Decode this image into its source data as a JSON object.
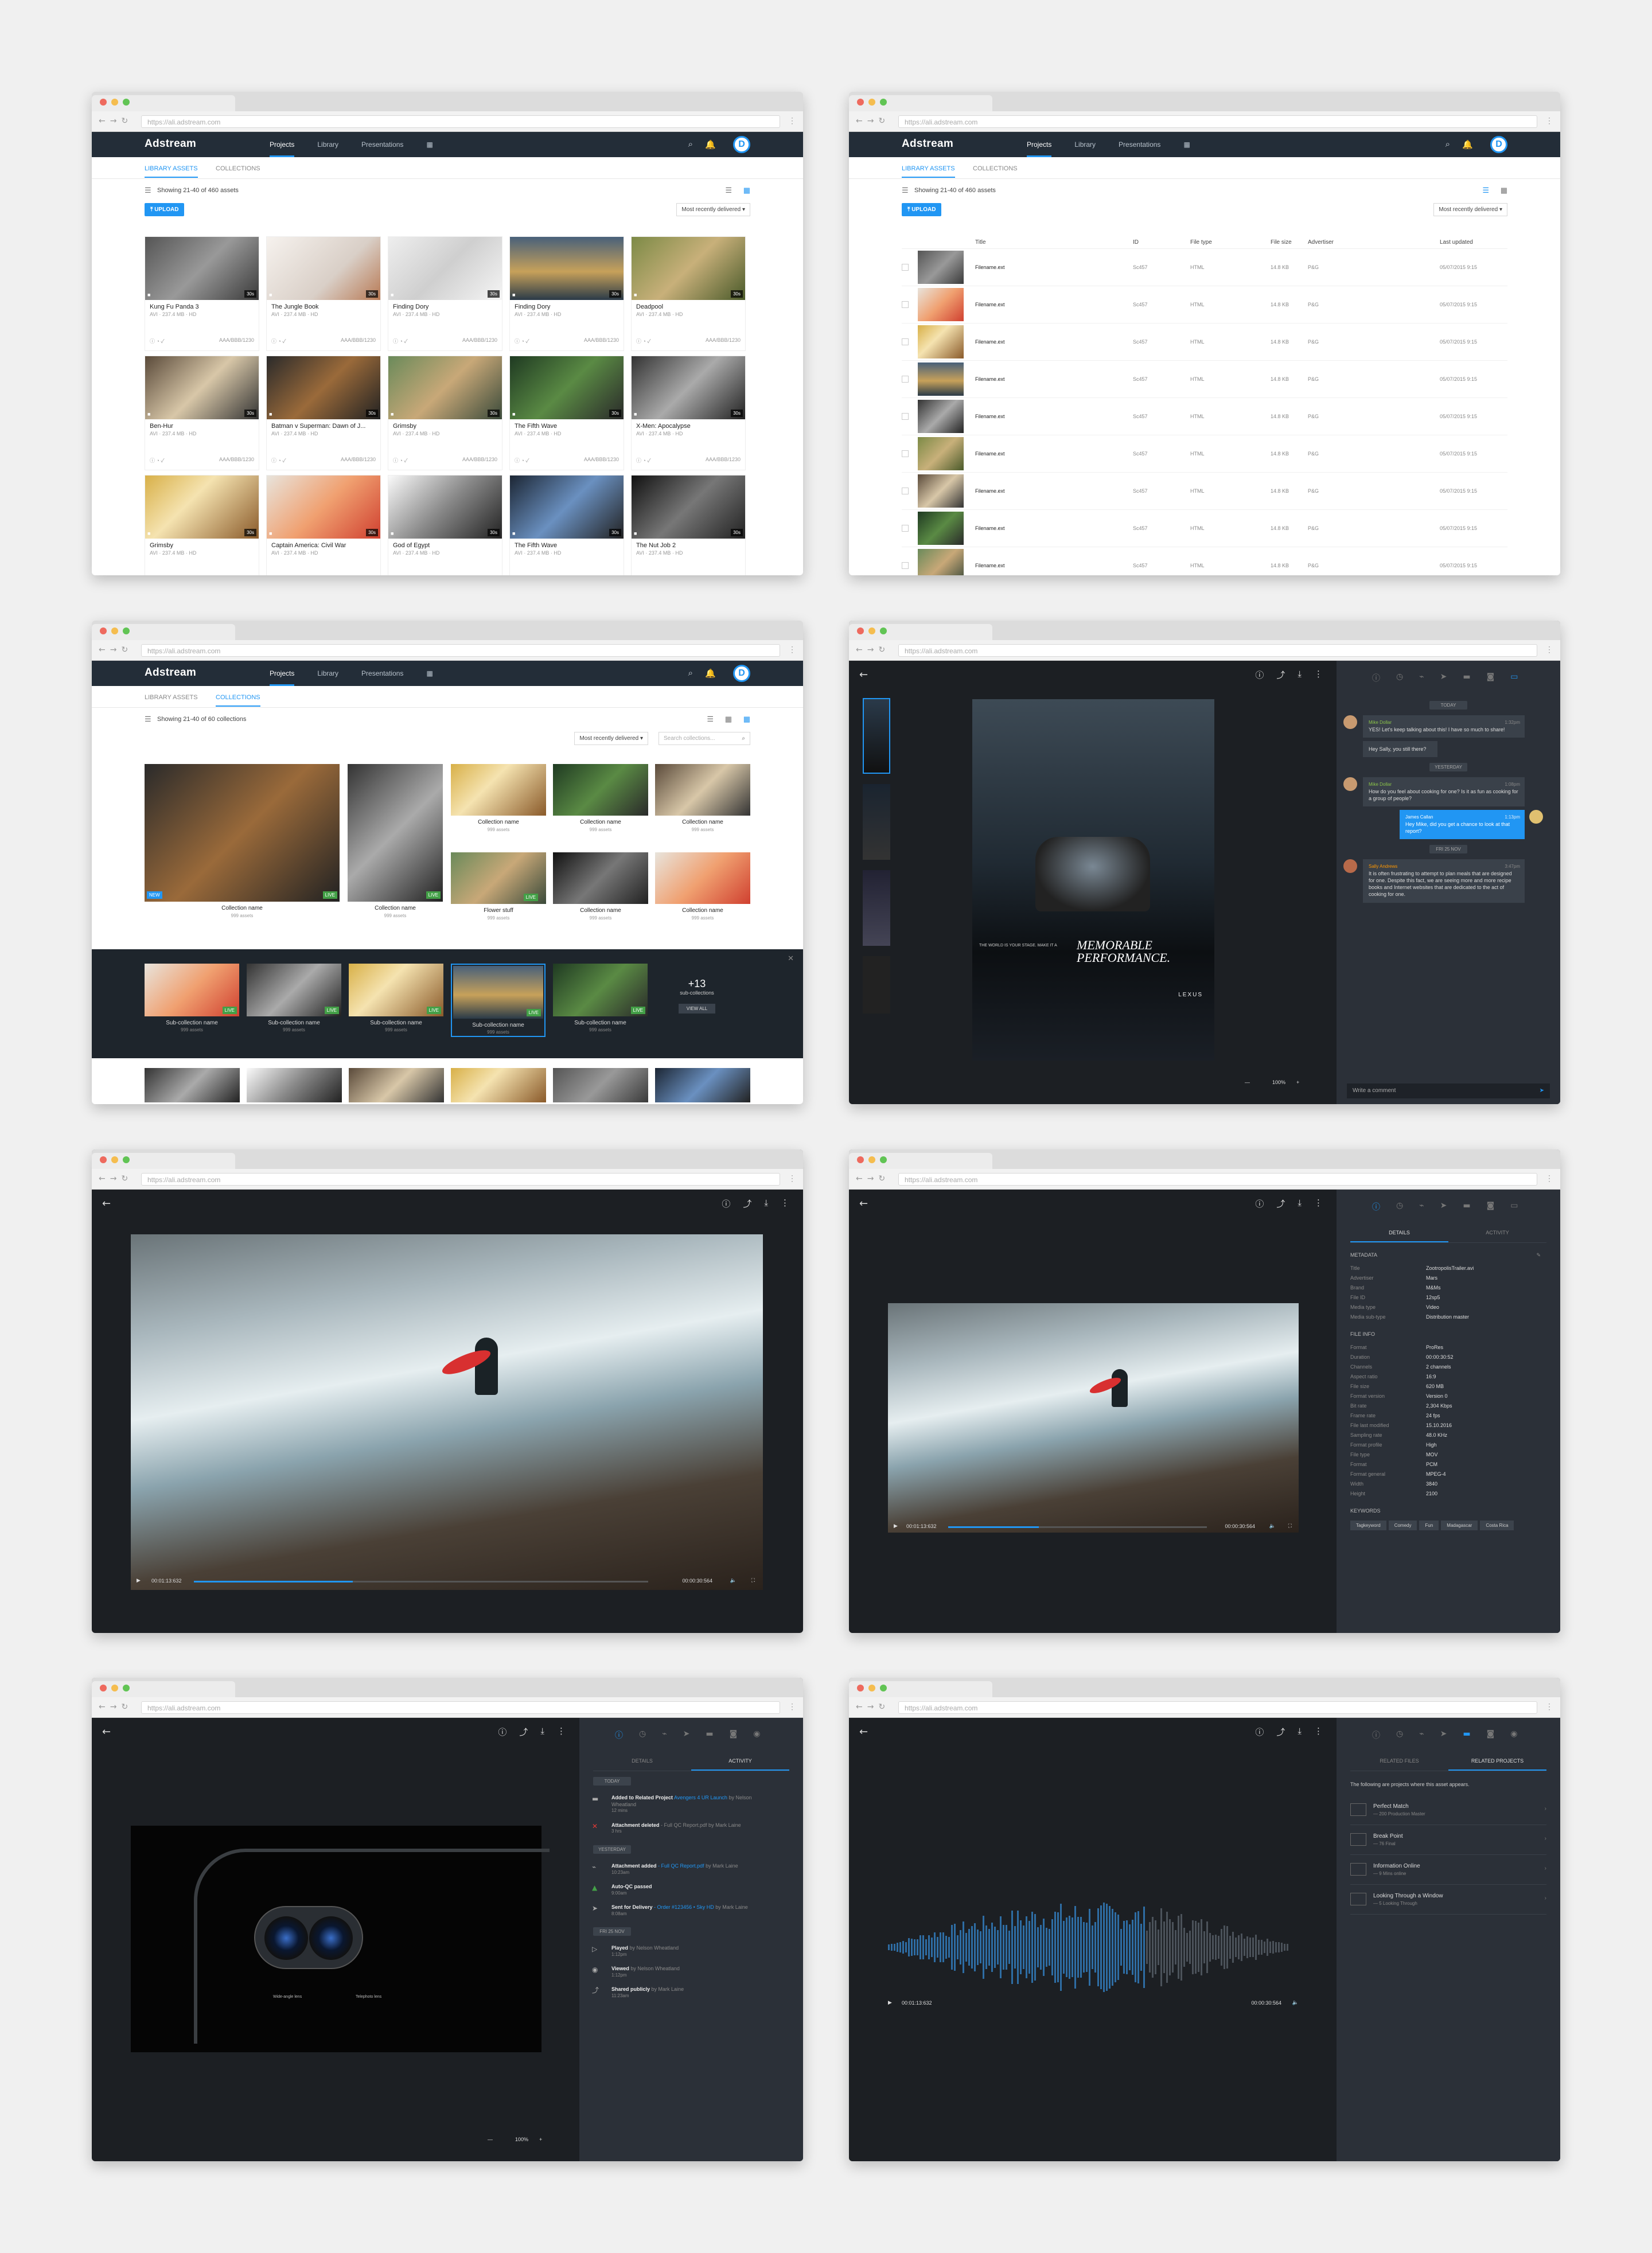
{
  "browser": {
    "url": "https://ali.adstream.com"
  },
  "app": {
    "logo": "Adstream",
    "nav": [
      "Projects",
      "Library",
      "Presentations"
    ],
    "avatar": "D",
    "colors": {
      "accent": "#2196f3",
      "appbar": "#232d38",
      "dark": "#1c1f23",
      "live": "#43a047"
    }
  },
  "library": {
    "tabs": [
      "LIBRARY ASSETS",
      "COLLECTIONS"
    ],
    "showing": "Showing 21-40 of 460 assets",
    "upload": "UPLOAD",
    "sort": "Most recently delivered",
    "cards": [
      {
        "title": "Kung Fu Panda 3",
        "meta": "AVI · 237.4 MB · HD",
        "code": "AAA/BBB/1230",
        "dur": "30s"
      },
      {
        "title": "The Jungle Book",
        "meta": "AVI · 237.4 MB · HD",
        "code": "AAA/BBB/1230",
        "dur": "30s"
      },
      {
        "title": "Finding Dory",
        "meta": "AVI · 237.4 MB · HD",
        "code": "AAA/BBB/1230",
        "dur": "30s"
      },
      {
        "title": "Finding Dory",
        "meta": "AVI · 237.4 MB · HD",
        "code": "AAA/BBB/1230",
        "dur": "30s"
      },
      {
        "title": "Deadpool",
        "meta": "AVI · 237.4 MB · HD",
        "code": "AAA/BBB/1230",
        "dur": "30s"
      },
      {
        "title": "Ben-Hur",
        "meta": "AVI · 237.4 MB · HD",
        "code": "AAA/BBB/1230",
        "dur": "30s"
      },
      {
        "title": "Batman v Superman: Dawn of J...",
        "meta": "AVI · 237.4 MB · HD",
        "code": "AAA/BBB/1230",
        "dur": "30s"
      },
      {
        "title": "Grimsby",
        "meta": "AVI · 237.4 MB · HD",
        "code": "AAA/BBB/1230",
        "dur": "30s"
      },
      {
        "title": "The Fifth Wave",
        "meta": "AVI · 237.4 MB · HD",
        "code": "AAA/BBB/1230",
        "dur": "30s"
      },
      {
        "title": "X-Men: Apocalypse",
        "meta": "AVI · 237.4 MB · HD",
        "code": "AAA/BBB/1230",
        "dur": "30s"
      },
      {
        "title": "Grimsby",
        "meta": "AVI · 237.4 MB · HD",
        "code": "",
        "dur": "30s"
      },
      {
        "title": "Captain America: Civil War",
        "meta": "AVI · 237.4 MB · HD",
        "code": "",
        "dur": "30s"
      },
      {
        "title": "God of Egypt",
        "meta": "AVI · 237.4 MB · HD",
        "code": "",
        "dur": "30s"
      },
      {
        "title": "The Fifth Wave",
        "meta": "AVI · 237.4 MB · HD",
        "code": "",
        "dur": "30s"
      },
      {
        "title": "The Nut Job 2",
        "meta": "AVI · 237.4 MB · HD",
        "code": "",
        "dur": "30s"
      }
    ]
  },
  "listview": {
    "columns": [
      "Title",
      "ID",
      "File type",
      "File size",
      "Advertiser",
      "Last updated"
    ],
    "rows": [
      {
        "name": "Filename.ext",
        "id": "Sc457",
        "type": "HTML",
        "size": "14.8 KB",
        "adv": "P&G",
        "date": "05/07/2015 9:15"
      },
      {
        "name": "Filename.ext",
        "id": "Sc457",
        "type": "HTML",
        "size": "14.8 KB",
        "adv": "P&G",
        "date": "05/07/2015 9:15"
      },
      {
        "name": "Filename.ext",
        "id": "Sc457",
        "type": "HTML",
        "size": "14.8 KB",
        "adv": "P&G",
        "date": "05/07/2015 9:15"
      },
      {
        "name": "Filename.ext",
        "id": "Sc457",
        "type": "HTML",
        "size": "14.8 KB",
        "adv": "P&G",
        "date": "05/07/2015 9:15"
      },
      {
        "name": "Filename.ext",
        "id": "Sc457",
        "type": "HTML",
        "size": "14.8 KB",
        "adv": "P&G",
        "date": "05/07/2015 9:15"
      },
      {
        "name": "Filename.ext",
        "id": "Sc457",
        "type": "HTML",
        "size": "14.8 KB",
        "adv": "P&G",
        "date": "05/07/2015 9:15"
      },
      {
        "name": "Filename.ext",
        "id": "Sc457",
        "type": "HTML",
        "size": "14.8 KB",
        "adv": "P&G",
        "date": "05/07/2015 9:15"
      },
      {
        "name": "Filename.ext",
        "id": "Sc457",
        "type": "HTML",
        "size": "14.8 KB",
        "adv": "P&G",
        "date": "05/07/2015 9:15"
      },
      {
        "name": "Filename.ext",
        "id": "Sc457",
        "type": "HTML",
        "size": "14.8 KB",
        "adv": "P&G",
        "date": "05/07/2015 9:15"
      }
    ]
  },
  "collections": {
    "showing": "Showing 21-40 of 60 collections",
    "search_placeholder": "Search collections...",
    "items": [
      {
        "name": "Collection name",
        "count": "999 assets"
      },
      {
        "name": "Collection name",
        "count": "999 assets"
      },
      {
        "name": "Collection name",
        "count": "999 assets"
      },
      {
        "name": "Collection name",
        "count": "999 assets"
      },
      {
        "name": "Collection name",
        "count": "999 assets"
      },
      {
        "name": "Flower stuff",
        "count": "999 assets"
      },
      {
        "name": "Collection name",
        "count": "999 assets"
      },
      {
        "name": "Collection name",
        "count": "999 assets"
      }
    ],
    "badges": {
      "new": "NEW",
      "live": "LIVE"
    },
    "sub": [
      {
        "name": "Sub-collection name",
        "count": "999 assets"
      },
      {
        "name": "Sub-collection name",
        "count": "999 assets"
      },
      {
        "name": "Sub-collection name",
        "count": "999 assets"
      },
      {
        "name": "Sub-collection name",
        "count": "999 assets"
      },
      {
        "name": "Sub-collection name",
        "count": "999 assets"
      }
    ],
    "more_count": "+13",
    "more_label": "sub-collections",
    "view_all": "VIEW ALL"
  },
  "comments": {
    "days": [
      "TODAY",
      "YESTERDAY",
      "FRI 25 NOV"
    ],
    "messages": [
      {
        "who": "Mike Dollar",
        "time": "1:32pm",
        "text": "YES! Let's keep talking about this! I have so much to share!"
      },
      {
        "who": "",
        "time": "",
        "text": "Hey Sally, you still there?"
      },
      {
        "who": "Mike Dollar",
        "time": "1:08pm",
        "text": "How do you feel about cooking for one? Is it as fun as cooking for a group of people?"
      },
      {
        "who": "James Callan",
        "time": "1:13pm",
        "text": "Hey Mike, did you get a chance to look at that report?"
      },
      {
        "who": "Sally Andrews",
        "time": "3:47pm",
        "text": "It is often frustrating to attempt to plan meals that are designed for one. Despite this fact, we are seeing more and more recipe books and Internet websites that are dedicated to the act of cooking for one."
      }
    ],
    "input_placeholder": "Write a comment",
    "zoom": "100%",
    "ad_headline": "MEMORABLE PERFORMANCE.",
    "ad_tagline": "THE WORLD IS YOUR STAGE. MAKE IT A",
    "ad_brand": "LEXUS"
  },
  "player": {
    "time": "00:01:13:632",
    "duration": "00:00:30:564",
    "progress_pct": 35
  },
  "details": {
    "tabs": [
      "DETAILS",
      "ACTIVITY"
    ],
    "metadata_head": "METADATA",
    "metadata": [
      [
        "Title",
        "ZootropolisTrailer.avi"
      ],
      [
        "Advertiser",
        "Mars"
      ],
      [
        "Brand",
        "M&Ms"
      ],
      [
        "File ID",
        "12sp5"
      ],
      [
        "Media type",
        "Video"
      ],
      [
        "Media sub-type",
        "Distribution master"
      ]
    ],
    "fileinfo_head": "FILE INFO",
    "fileinfo": [
      [
        "Format",
        "ProRes"
      ],
      [
        "Duration",
        "00:00:30:52"
      ],
      [
        "Channels",
        "2 channels"
      ],
      [
        "Aspect ratio",
        "16:9"
      ],
      [
        "File size",
        "620 MB"
      ],
      [
        "Format version",
        "Version 0"
      ],
      [
        "Bit rate",
        "2,304 Kbps"
      ],
      [
        "Frame rate",
        "24 fps"
      ],
      [
        "File last modified",
        "15.10.2016"
      ],
      [
        "Sampling rate",
        "48.0 KHz"
      ],
      [
        "Format profile",
        "High"
      ],
      [
        "File type",
        "MOV"
      ],
      [
        "Format",
        "PCM"
      ],
      [
        "Format general",
        "MPEG-4"
      ],
      [
        "Width",
        "3840"
      ],
      [
        "Height",
        "2100"
      ]
    ],
    "keywords_head": "KEYWORDS",
    "keywords": [
      "Tagkeyword",
      "Comedy",
      "Fun",
      "Madagascar",
      "Costa Rica"
    ]
  },
  "activity": {
    "days": [
      "TODAY",
      "YESTERDAY",
      "FRI 25 NOV"
    ],
    "items": [
      {
        "title": "Added to Related Project",
        "link": "Avengers 4 UR Launch",
        "by": "by Nelson Wheatland",
        "time": "12 mins"
      },
      {
        "title": "Attachment deleted",
        "link": "",
        "by": "- Full QC Report.pdf by Mark Laine",
        "time": "3 hrs"
      },
      {
        "title": "Attachment added",
        "link": "- Full QC Report.pdf",
        "by": "by Mark Laine",
        "time": "10:23am"
      },
      {
        "title": "Auto-QC passed",
        "link": "",
        "by": "",
        "time": "9:00am"
      },
      {
        "title": "Sent for Delivery",
        "link": "- Order #123456 • Sky HD",
        "by": "by Mark Laine",
        "time": "8:08am"
      },
      {
        "title": "Played",
        "link": "",
        "by": "by Nelson Wheatland",
        "time": "1:12pm"
      },
      {
        "title": "Viewed",
        "link": "",
        "by": "by Nelson Wheatland",
        "time": "1:12pm"
      },
      {
        "title": "Shared publicly",
        "link": "",
        "by": "by Mark Laine",
        "time": "11:23am"
      }
    ],
    "zoom": "100%",
    "lens_labels": [
      "Wide-angle lens",
      "Telephoto lens"
    ]
  },
  "related": {
    "tabs": [
      "RELATED FILES",
      "RELATED PROJECTS"
    ],
    "intro": "The following are projects where this asset appears.",
    "items": [
      {
        "name": "Perfect Match",
        "sub": "— 200 Production Master"
      },
      {
        "name": "Break Point",
        "sub": "— 76 Final"
      },
      {
        "name": "Information Online",
        "sub": "— 9 Mins online"
      },
      {
        "name": "Looking Through a Window",
        "sub": "— 5 Looking Through"
      }
    ]
  }
}
